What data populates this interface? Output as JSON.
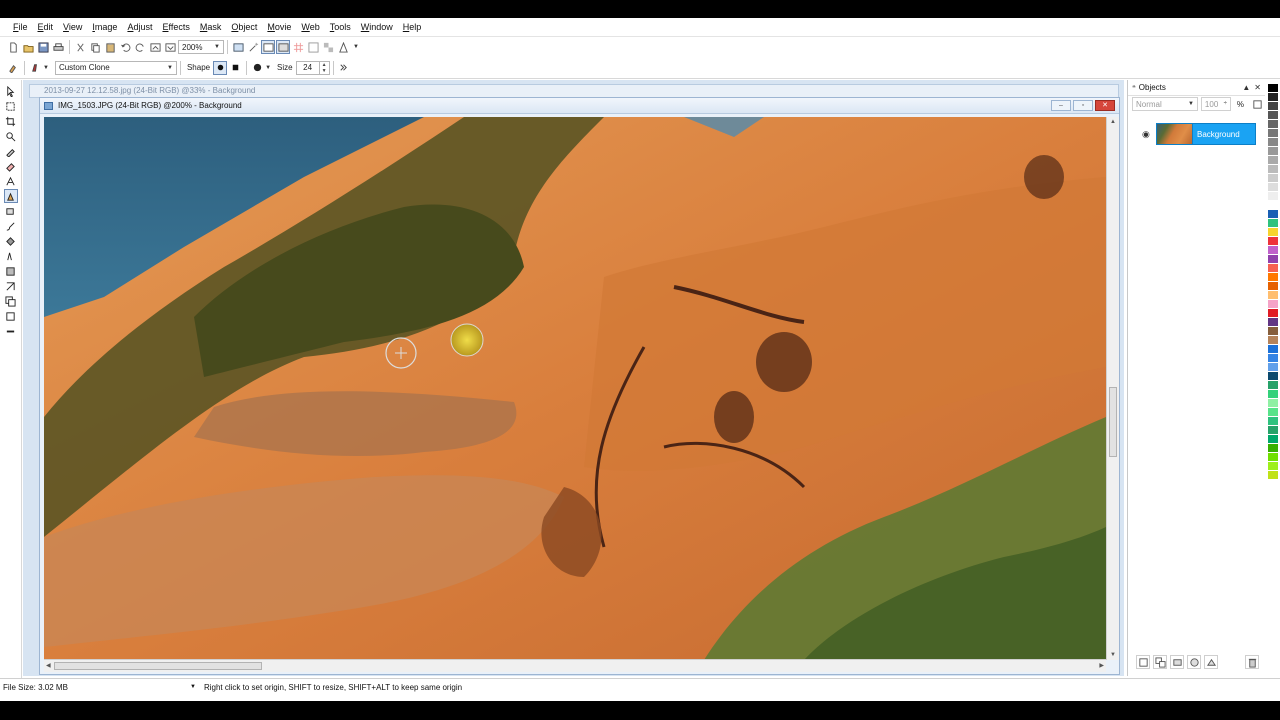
{
  "menu": [
    "File",
    "Edit",
    "View",
    "Image",
    "Adjust",
    "Effects",
    "Mask",
    "Object",
    "Movie",
    "Web",
    "Tools",
    "Window",
    "Help"
  ],
  "toolbar": {
    "zoom_value": "200%"
  },
  "property_bar": {
    "tool_mode": "Custom Clone",
    "shape_label": "Shape",
    "size_label": "Size",
    "size_value": "24"
  },
  "documents": {
    "background_doc": "2013-09-27 12.12.58.jpg (24-Bit RGB) @33% - Background",
    "active_doc": "IMG_1503.JPG (24-Bit RGB) @200% - Background"
  },
  "objects_panel": {
    "title": "Objects",
    "blend_mode": "Normal",
    "opacity": "100",
    "opacity_unit": "%",
    "layer_name": "Background"
  },
  "status": {
    "file_size": "File Size: 3.02 MB",
    "hint": "Right click to set origin, SHIFT to resize, SHIFT+ALT to keep same origin"
  },
  "palette_colors": [
    "#000000",
    "#222222",
    "#444444",
    "#555555",
    "#666666",
    "#777777",
    "#888888",
    "#999999",
    "#aaaaaa",
    "#bbbbbb",
    "#cccccc",
    "#dddddd",
    "#eeeeee",
    "#ffffff",
    "#1a5fb4",
    "#2ec27e",
    "#f6d32d",
    "#ed333b",
    "#c061cb",
    "#9141ac",
    "#f66151",
    "#ff7800",
    "#e66100",
    "#ffbe6f",
    "#f5a3c7",
    "#e01b24",
    "#613583",
    "#865e3c",
    "#b5835a",
    "#1c71d8",
    "#3584e4",
    "#62a0ea",
    "#0c4a6e",
    "#26a269",
    "#33d17a",
    "#8ff0a4",
    "#57e389",
    "#2ec27e",
    "#26a269",
    "#00a86b",
    "#38b000",
    "#70e000",
    "#9ef01a",
    "#c0e218",
    "#ffffff"
  ]
}
